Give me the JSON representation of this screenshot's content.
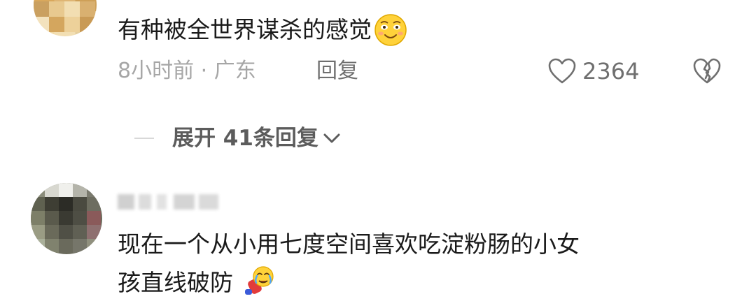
{
  "comments": [
    {
      "text": "有种被全世界谋杀的感觉",
      "emoji": "smiling-face-with-smiling-eyes",
      "time_location": "8小时前 · 广东",
      "reply_label": "回复",
      "like_count": "2364",
      "expand_label": "展开 41条回复"
    },
    {
      "text_line1": "现在一个从小用七度空间喜欢吃淀粉肠的小女",
      "text_line2": "孩直线破防",
      "emoji": "crying-bending-person"
    }
  ],
  "icons": {
    "like": "heart-outline-icon",
    "dislike": "broken-heart-outline-icon",
    "expand": "chevron-down-icon"
  },
  "colors": {
    "text_primary": "#1a1a1a",
    "text_meta": "#a6a6a6",
    "text_action": "#6f6f6f",
    "divider": "#d8d8d8"
  }
}
